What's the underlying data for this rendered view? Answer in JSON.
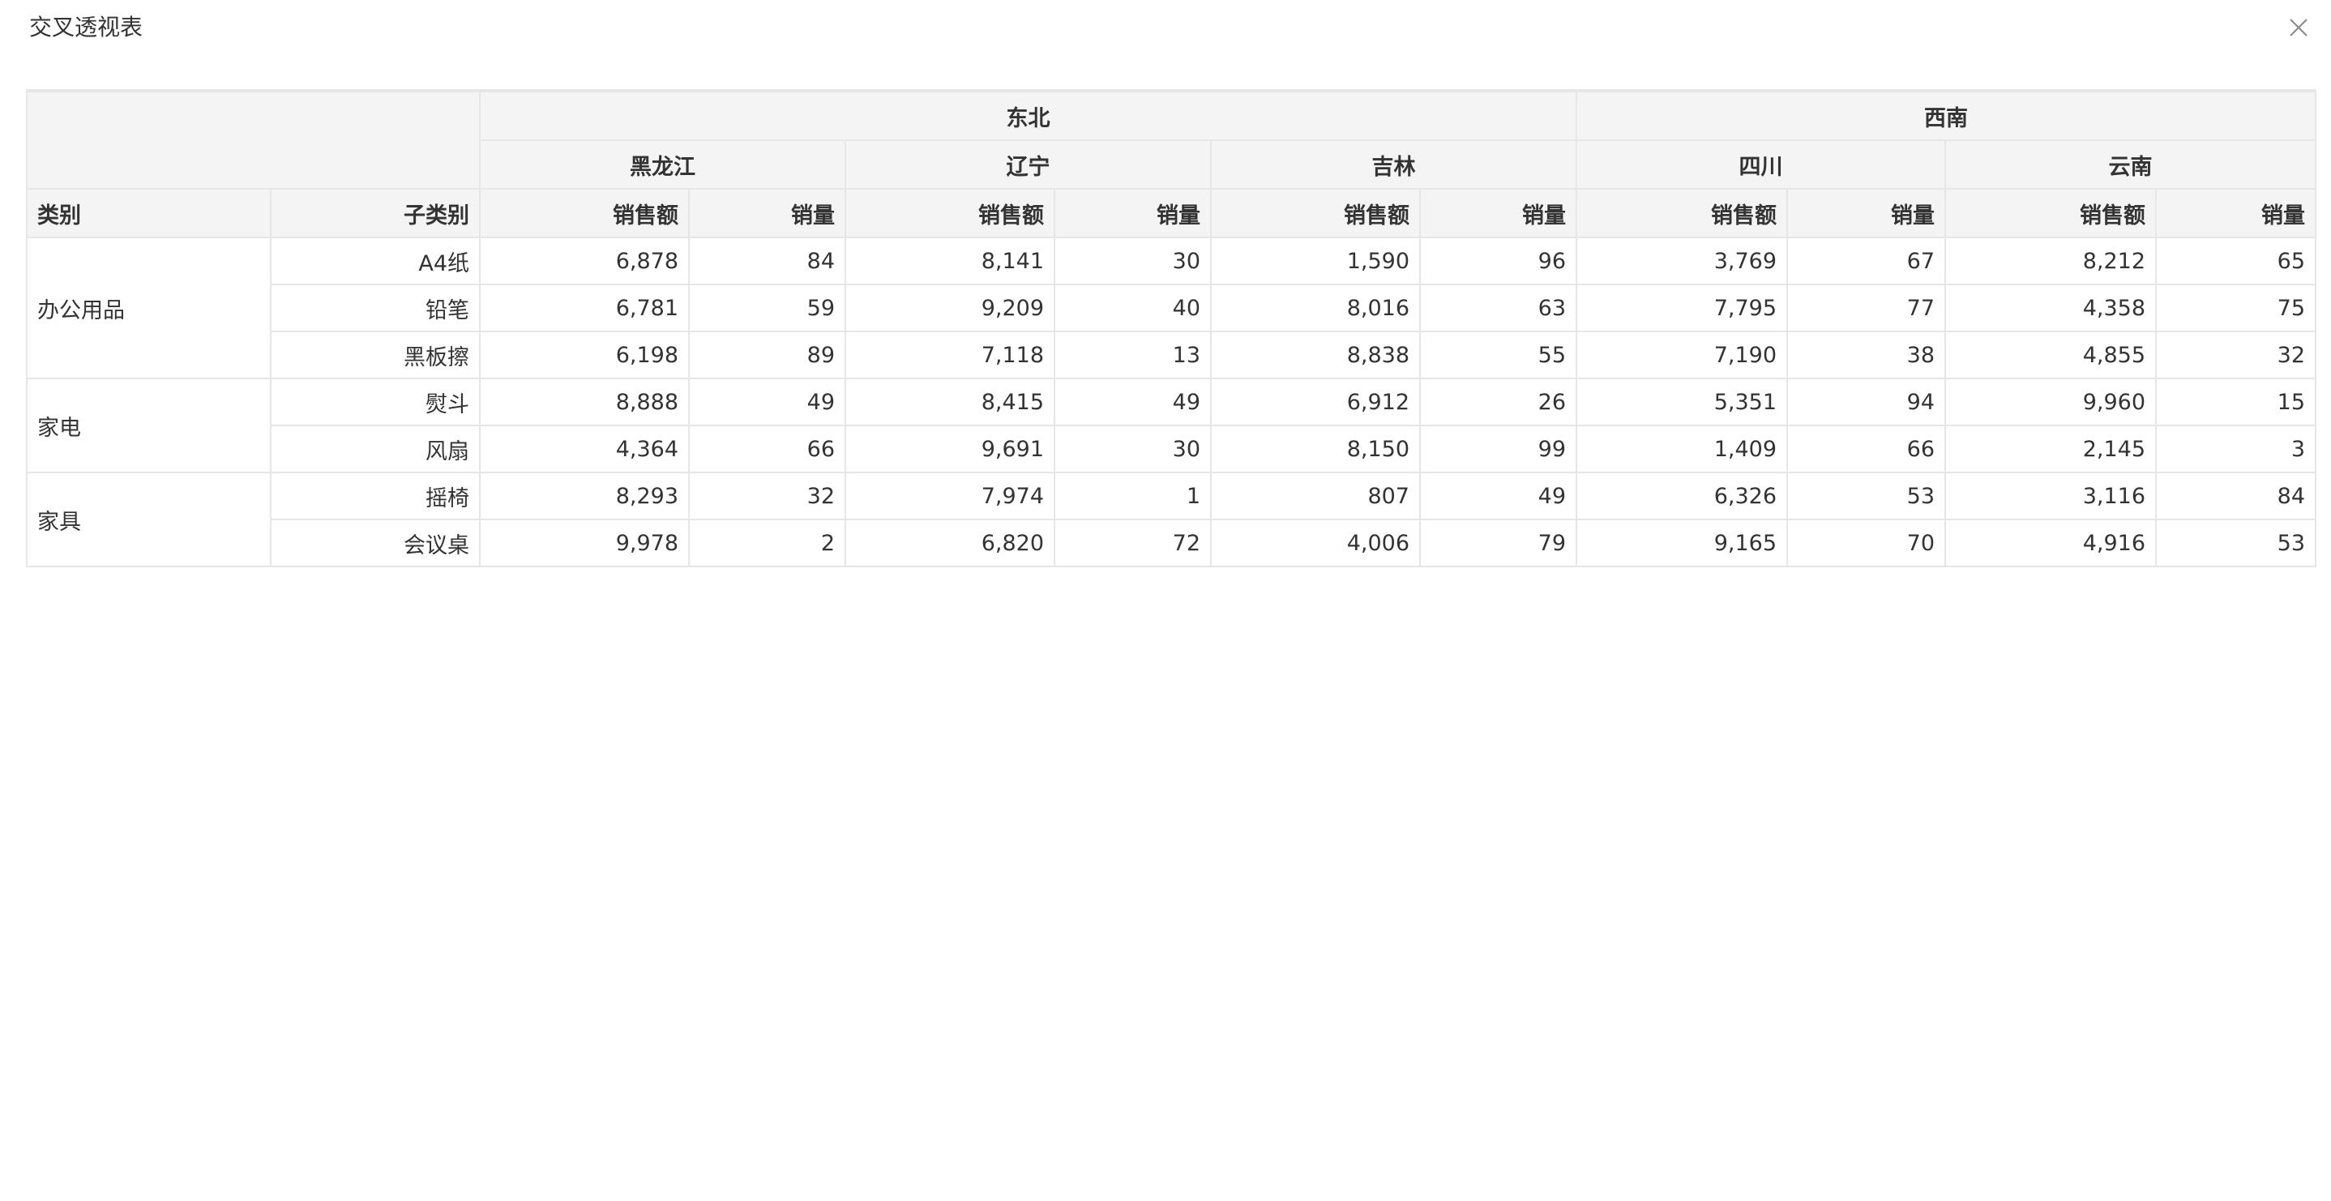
{
  "dialog": {
    "title": "交叉透视表",
    "close_icon": "close-icon"
  },
  "pivot": {
    "row_headers": [
      "类别",
      "子类别"
    ],
    "measures": [
      "销售额",
      "销量"
    ],
    "regions": [
      {
        "name": "东北",
        "provinces": [
          "黑龙江",
          "辽宁",
          "吉林"
        ]
      },
      {
        "name": "西南",
        "provinces": [
          "四川",
          "云南"
        ]
      }
    ],
    "categories": [
      {
        "name": "办公用品",
        "rows": [
          {
            "sub": "A4纸",
            "values": [
              "6,878",
              "84",
              "8,141",
              "30",
              "1,590",
              "96",
              "3,769",
              "67",
              "8,212",
              "65"
            ]
          },
          {
            "sub": "铅笔",
            "values": [
              "6,781",
              "59",
              "9,209",
              "40",
              "8,016",
              "63",
              "7,795",
              "77",
              "4,358",
              "75"
            ]
          },
          {
            "sub": "黑板擦",
            "values": [
              "6,198",
              "89",
              "7,118",
              "13",
              "8,838",
              "55",
              "7,190",
              "38",
              "4,855",
              "32"
            ]
          }
        ]
      },
      {
        "name": "家电",
        "rows": [
          {
            "sub": "熨斗",
            "values": [
              "8,888",
              "49",
              "8,415",
              "49",
              "6,912",
              "26",
              "5,351",
              "94",
              "9,960",
              "15"
            ]
          },
          {
            "sub": "风扇",
            "values": [
              "4,364",
              "66",
              "9,691",
              "30",
              "8,150",
              "99",
              "1,409",
              "66",
              "2,145",
              "3"
            ]
          }
        ]
      },
      {
        "name": "家具",
        "rows": [
          {
            "sub": "摇椅",
            "values": [
              "8,293",
              "32",
              "7,974",
              "1",
              "807",
              "49",
              "6,326",
              "53",
              "3,116",
              "84"
            ]
          },
          {
            "sub": "会议桌",
            "values": [
              "9,978",
              "2",
              "6,820",
              "72",
              "4,006",
              "79",
              "9,165",
              "70",
              "4,916",
              "53"
            ]
          }
        ]
      }
    ]
  }
}
